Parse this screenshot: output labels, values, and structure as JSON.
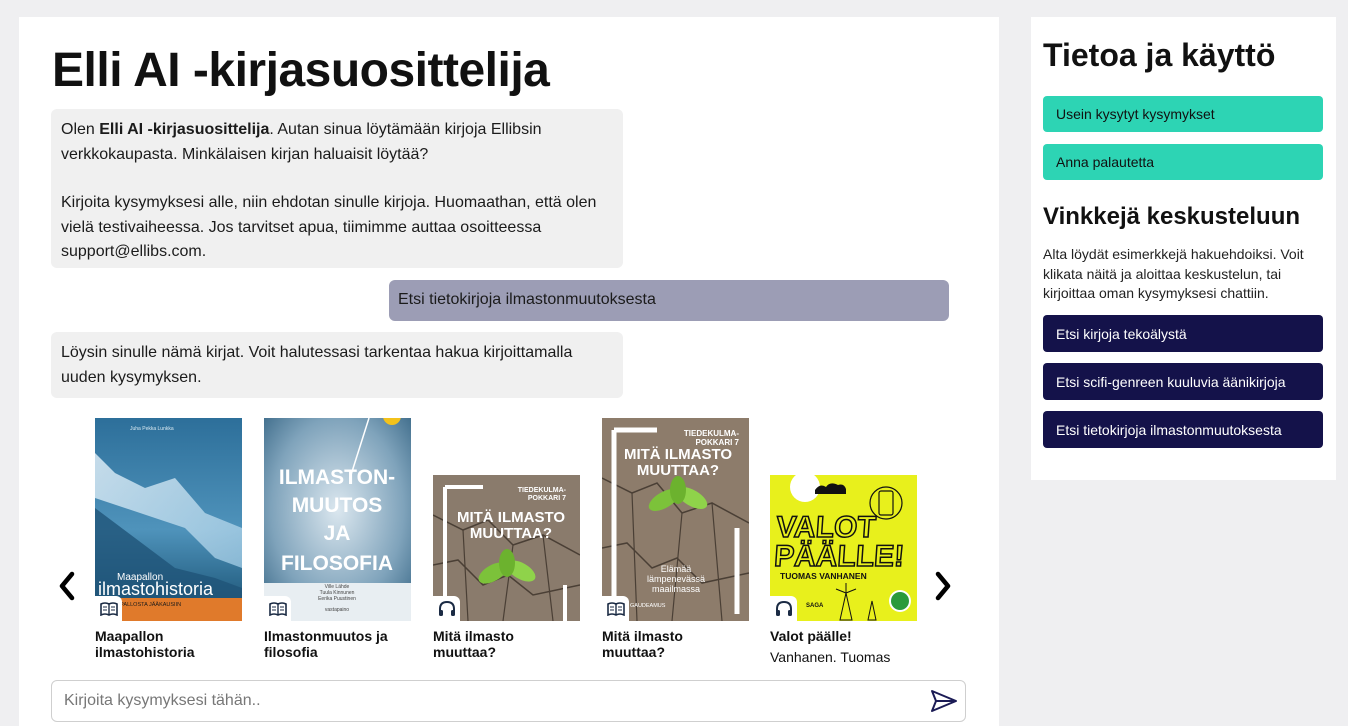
{
  "main": {
    "title": "Elli AI -kirjasuosittelija",
    "messages": [
      {
        "role": "bot",
        "intro_prefix": "Olen ",
        "intro_bold": "Elli AI -kirjasuosittelija",
        "intro_suffix": ". Autan sinua löytämään kirjoja Ellibsin verkkokaupasta. Minkälaisen kirjan haluaisit löytää?",
        "paragraph2": "Kirjoita kysymyksesi alle, niin ehdotan sinulle kirjoja. Huomaathan, että olen vielä testivaiheessa. Jos tarvitset apua, tiimimme auttaa osoitteessa support@ellibs.com."
      },
      {
        "role": "user",
        "text": "Etsi tietokirjoja ilmastonmuutoksesta"
      },
      {
        "role": "bot",
        "text": "Löysin sinulle nämä kirjat. Voit halutessasi tarkentaa hakua kirjoittamalla uuden kysymyksen."
      }
    ],
    "books": [
      {
        "title": "Maapallon ilmastohistoria",
        "author": "",
        "format": "ebook",
        "format_icon": "book-icon",
        "cover_author": "Juha Pekka Lunkka",
        "cover_title_small": "Maapallon",
        "cover_title_large": "ilmastohistoria",
        "cover_subtitle": "LUMIPALLOSTA JÄÄKAUSIIN"
      },
      {
        "title": "Ilmastonmuutos ja filosofia",
        "author": "",
        "format": "ebook",
        "format_icon": "book-icon",
        "cover_lines": [
          "ILMASTON-",
          "MUUTOS",
          "JA",
          "FILOSOFIA"
        ],
        "cover_editors": "Ville Lähde\nTuula Kinnunen\nEerika Puustinen",
        "cover_publisher": "vastapaino"
      },
      {
        "title": "Mitä ilmasto muuttaa?",
        "author": "",
        "format": "audiobook",
        "format_icon": "headphones-icon",
        "cover_series": "TIEDEKULMA-\nPOKKARI 7",
        "cover_title": "MITÄ ILMASTO\nMUUTTAA?"
      },
      {
        "title": "Mitä ilmasto muuttaa?",
        "author": "",
        "format": "ebook",
        "format_icon": "book-icon",
        "cover_series": "TIEDEKULMA-\nPOKKARI 7",
        "cover_title": "MITÄ ILMASTO\nMUUTTAA?",
        "cover_subtitle": "Elämää\nlämpenevässä\nmaailmassa",
        "cover_publisher": "GAUDEAMUS"
      },
      {
        "title": "Valot päälle!",
        "author": "Vanhanen. Tuomas",
        "format": "audiobook",
        "format_icon": "headphones-icon",
        "cover_lines": [
          "VALOT",
          "PÄÄLLE!"
        ],
        "cover_author": "TUOMAS VANHANEN",
        "cover_publisher": "SAGA"
      }
    ],
    "input_placeholder": "Kirjoita kysymyksesi tähän.."
  },
  "side": {
    "title": "Tietoa ja käyttö",
    "faq_label": "Usein kysytyt kysymykset",
    "feedback_label": "Anna palautetta",
    "tips_title": "Vinkkejä keskusteluun",
    "tips_text": "Alta löydät esimerkkejä hakuehdoiksi. Voit klikata näitä ja aloittaa keskustelun, tai kirjoittaa oman kysymyksesi chattiin.",
    "suggestions": [
      "Etsi kirjoja tekoälystä",
      "Etsi scifi-genreen kuuluvia äänikirjoja",
      "Etsi tietokirjoja ilmastonmuutoksesta"
    ]
  },
  "colors": {
    "teal": "#2dd4b4",
    "navy": "#14124a",
    "user_bubble": "#9c9db5",
    "bot_bubble": "#f0f0f0"
  }
}
